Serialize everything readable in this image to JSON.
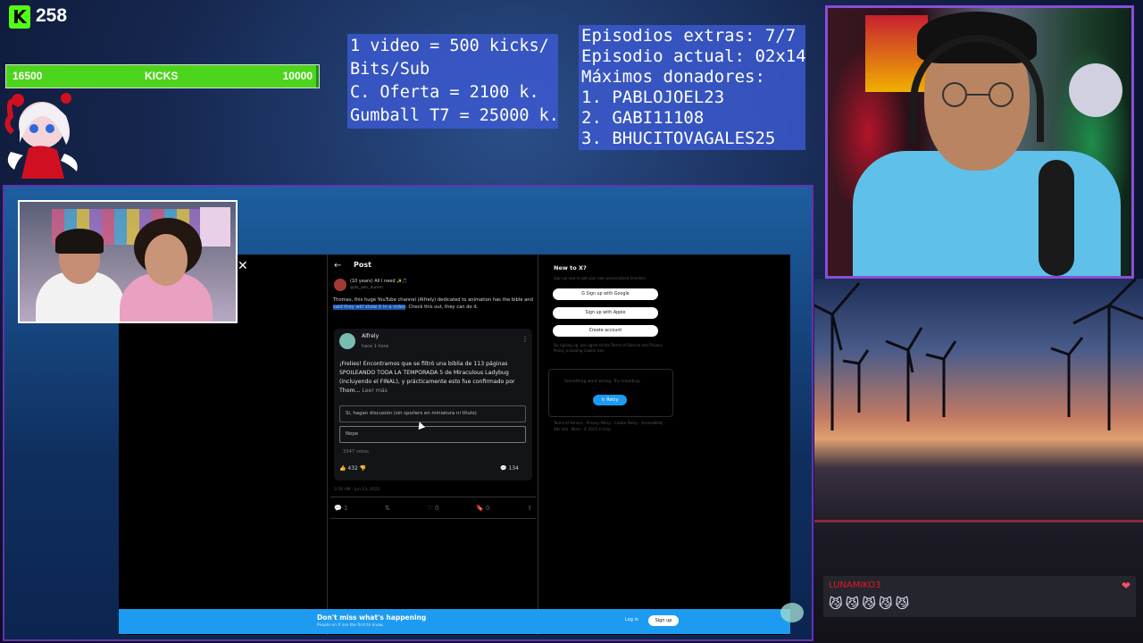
{
  "kick": {
    "icon": "kick-logo-icon",
    "logo_letter": "K",
    "count": "258"
  },
  "goal_bar": {
    "left": "16500",
    "label": "KICKS",
    "right": "10000",
    "fill_fraction": 0.99
  },
  "info_kicks": {
    "lines": [
      "1 video = 500 kicks/",
      "Bits/Sub",
      "C. Oferta = 2100 k.",
      "Gumball T7 = 25000 k."
    ]
  },
  "info_episodes": {
    "lines": [
      "Episodios extras: 7/7",
      "Episodio actual: 02x14",
      "Máximos donadores:",
      "1. PABLOJOEL23",
      "2. GABI11108",
      "3. BHUCITOVAGALES25"
    ]
  },
  "browser": {
    "close_glyph": "✕",
    "back_glyph": "←",
    "post_title": "Post",
    "author": "(10 years) All I need ✨🎵",
    "handle": "@its_zen_dumm",
    "text_before": "Thomas, this huge YouTube channel (Alfrely) dedicated to animation has the bible and ",
    "text_highlight": "said they will show it in a video",
    "text_after": ". Check this out, they can do it.",
    "card": {
      "name": "Alfrely",
      "time": "hace 1 hora",
      "menu_glyph": "⋮",
      "text": "¡Frelies! Encontramos que se filtró una biblia de 113 páginas SPOILEANDO TODA LA TEMPORADA 5 de Miraculous Ladybug (incluyendo el FINAL), y prácticamente esto fue confirmado por Thom...",
      "more": "Leer más",
      "poll": [
        "Si, hagan discusión (sin spoilers en miniatura ni título)",
        "Nope"
      ],
      "votes": "3347 votos",
      "likes": "👍 432   👎",
      "comments": "💬 134"
    },
    "timestamp": "3:56 AM · Jun 13, 2022",
    "tweet_actions": [
      "💬 1",
      "⇅",
      "♡ 0",
      "🔖 0",
      "⇪"
    ],
    "sidebar": {
      "title": "New to X?",
      "subtitle": "Sign up now to get your own personalized timeline!",
      "buttons": [
        "G  Sign up with Google",
        "  Sign up with Apple",
        "Create account"
      ],
      "note": "By signing up, you agree to the Terms of Service and Privacy Policy, including Cookie Use.",
      "error": "Something went wrong. Try reloading.",
      "retry": "↻ Retry",
      "footer": "Terms of Service · Privacy Policy · Cookie Policy · Accessibility · Ads info · More · © 2025 X Corp."
    },
    "banner": {
      "title": "Don't miss what's happening",
      "subtitle": "People on X are the first to know.",
      "login": "Log in",
      "signup": "Sign up"
    }
  },
  "chat": {
    "user": "LUNAMIKO3",
    "emotes": "😼😼😼😼😼",
    "heart": "❤"
  }
}
